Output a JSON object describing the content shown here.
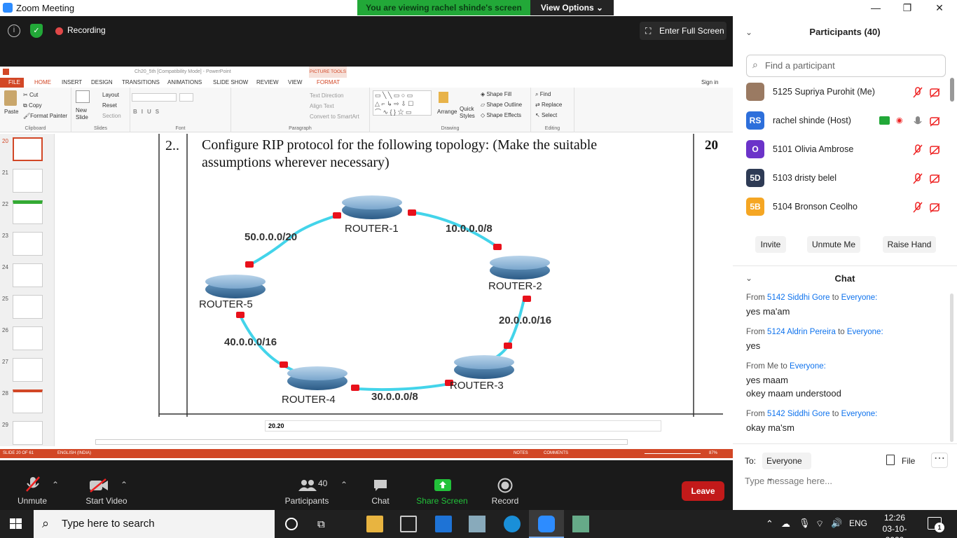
{
  "window": {
    "title": "Zoom Meeting"
  },
  "banner": {
    "viewing": "You are viewing rachel shinde's screen",
    "view_options": "View Options"
  },
  "meeting": {
    "recording": "Recording",
    "full_screen": "Enter Full Screen"
  },
  "ppt": {
    "title": "Ch20_5th [Compatibility Mode] - PowerPoint",
    "picture_tools": "PICTURE TOOLS",
    "sign_in": "Sign in",
    "tabs": [
      "FILE",
      "HOME",
      "INSERT",
      "DESIGN",
      "TRANSITIONS",
      "ANIMATIONS",
      "SLIDE SHOW",
      "REVIEW",
      "VIEW",
      "FORMAT"
    ],
    "ribbon": {
      "paste": "Paste",
      "cut": "Cut",
      "copy": "Copy",
      "format_painter": "Format Painter",
      "clipboard": "Clipboard",
      "new_slide": "New Slide",
      "layout": "Layout",
      "reset": "Reset",
      "section": "Section",
      "slides": "Slides",
      "font": "Font",
      "paragraph": "Paragraph",
      "text_direction": "Text Direction",
      "align_text": "Align Text",
      "smartart": "Convert to SmartArt",
      "arrange": "Arrange",
      "quick_styles": "Quick Styles",
      "shape_fill": "Shape Fill",
      "shape_outline": "Shape Outline",
      "shape_effects": "Shape Effects",
      "drawing": "Drawing",
      "find": "Find",
      "replace": "Replace",
      "select": "Select",
      "editing": "Editing"
    },
    "slide_numbers": [
      "20",
      "21",
      "22",
      "23",
      "24",
      "25",
      "26",
      "27",
      "28",
      "29"
    ],
    "slide": {
      "question_no": "2..",
      "question": "Configure RIP protocol for the following topology: (Make the suitable assumptions wherever necessary)",
      "marks": "20",
      "routers": [
        "ROUTER-1",
        "ROUTER-2",
        "ROUTER-3",
        "ROUTER-4",
        "ROUTER-5"
      ],
      "networks": [
        "10.0.0.0/8",
        "20.0.0.0/16",
        "30.0.0.0/8",
        "40.0.0.0/16",
        "50.0.0.0/20"
      ]
    },
    "notes": "20.20",
    "status": {
      "slide": "SLIDE 20 OF 61",
      "lang": "ENGLISH (INDIA)",
      "notes": "NOTES",
      "comments": "COMMENTS",
      "zoom": "87%"
    }
  },
  "toolbar": {
    "unmute": "Unmute",
    "start_video": "Start Video",
    "participants": "Participants",
    "participant_count": "40",
    "chat": "Chat",
    "share_screen": "Share Screen",
    "record": "Record",
    "leave": "Leave"
  },
  "participants": {
    "title": "Participants (40)",
    "search_placeholder": "Find a participant",
    "list": [
      {
        "initials": "",
        "name": "5125 Supriya Purohit (Me)",
        "color": "#8a6a55"
      },
      {
        "initials": "RS",
        "name": "rachel shinde (Host)",
        "color": "#2d6fdb"
      },
      {
        "initials": "O",
        "name": "5101 Olivia Ambrose",
        "color": "#6b33c9"
      },
      {
        "initials": "5D",
        "name": "5103 dristy belel",
        "color": "#2e3b55"
      },
      {
        "initials": "5B",
        "name": "5104 Bronson Ceolho",
        "color": "#f5a623"
      }
    ],
    "invite": "Invite",
    "unmute_me": "Unmute Me",
    "raise_hand": "Raise Hand"
  },
  "chat": {
    "title": "Chat",
    "messages": [
      {
        "from": "5142 Siddhi Gore",
        "to": "Everyone:",
        "lines": [
          "yes ma'am"
        ]
      },
      {
        "from": "5124 Aldrin Pereira",
        "to": "Everyone:",
        "lines": [
          "yes"
        ]
      },
      {
        "from": "Me",
        "to": "Everyone:",
        "lines": [
          "yes maam",
          "okey maam understood"
        ]
      },
      {
        "from": "5142 Siddhi Gore",
        "to": "Everyone:",
        "lines": [
          "okay ma'sm"
        ]
      }
    ],
    "from_word": "From",
    "to_word": "to",
    "to_label": "To:",
    "recipient": "Everyone",
    "file": "File",
    "placeholder": "Type message here..."
  },
  "taskbar": {
    "search": "Type here to search",
    "lang": "ENG",
    "time": "12:26",
    "date": "03-10-2020",
    "notif": "1"
  },
  "colors": {
    "zoom_blue": "#0e72ed",
    "leave_red": "#c21a1a",
    "share_green": "#22a838",
    "ppt_orange": "#d24726"
  }
}
